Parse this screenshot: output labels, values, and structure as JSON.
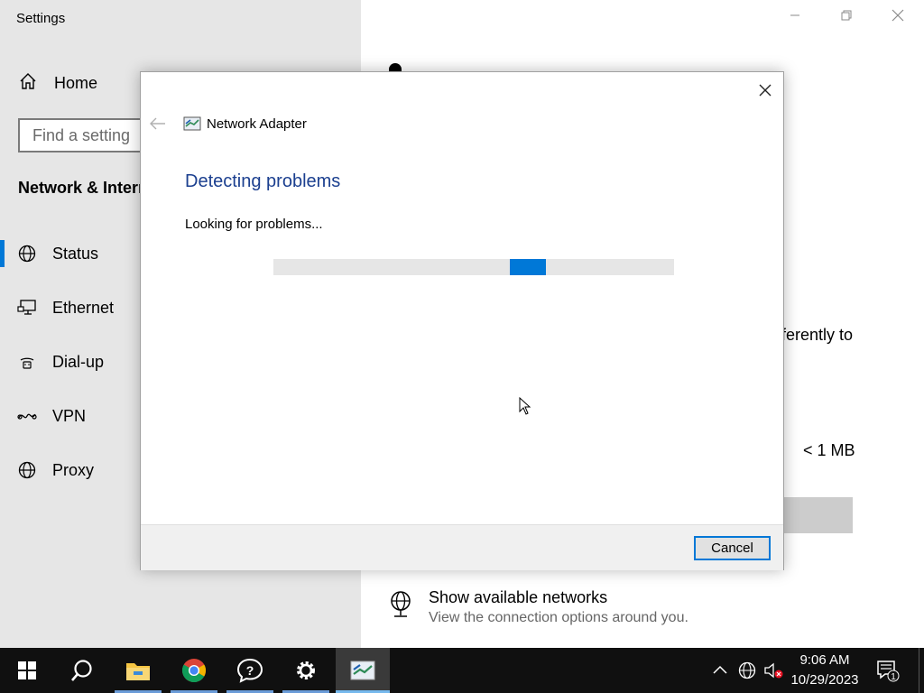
{
  "settings": {
    "title": "Settings",
    "home_label": "Home",
    "search_placeholder": "Find a setting",
    "section_title": "Network & Internet",
    "nav_items": [
      {
        "label": "Status",
        "icon": "globe-icon",
        "selected": true
      },
      {
        "label": "Ethernet",
        "icon": "ethernet-icon",
        "selected": false
      },
      {
        "label": "Dial-up",
        "icon": "dialup-icon",
        "selected": false
      },
      {
        "label": "VPN",
        "icon": "vpn-icon",
        "selected": false
      },
      {
        "label": "Proxy",
        "icon": "proxy-globe-icon",
        "selected": false
      }
    ],
    "right_partial_text": "ferently to",
    "right_data_usage": "< 1 MB",
    "show_networks": {
      "title": "Show available networks",
      "subtitle": "View the connection options around you."
    },
    "accent_color": "#0078d7"
  },
  "dialog": {
    "app_title": "Network Adapter",
    "heading": "Detecting problems",
    "status_text": "Looking for problems...",
    "cancel_label": "Cancel",
    "progress": {
      "type": "indeterminate",
      "chunk_start_fraction": 0.59,
      "chunk_width_fraction": 0.09
    },
    "heading_color": "#1b3f8f"
  },
  "taskbar": {
    "apps": [
      {
        "name": "start-button",
        "icon": "windows-logo-icon"
      },
      {
        "name": "search-button",
        "icon": "search-icon"
      },
      {
        "name": "file-explorer",
        "icon": "folder-icon"
      },
      {
        "name": "chrome",
        "icon": "chrome-icon"
      },
      {
        "name": "get-help",
        "icon": "help-chat-icon"
      },
      {
        "name": "settings-app",
        "icon": "gear-icon"
      },
      {
        "name": "network-adapter-troubleshooter",
        "icon": "network-adapter-icon"
      }
    ],
    "clock_time": "9:06 AM",
    "clock_date": "10/29/2023"
  }
}
